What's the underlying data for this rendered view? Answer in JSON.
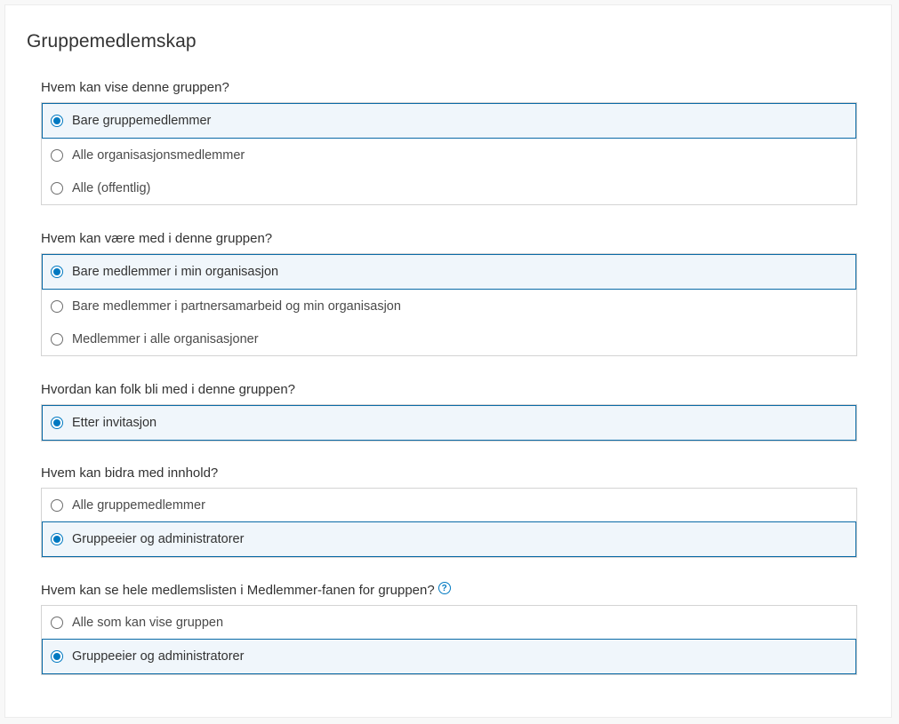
{
  "title": "Gruppemedlemskap",
  "colors": {
    "accent": "#0079c1",
    "selected_bg": "#f0f6fb",
    "border": "#d3d3d3"
  },
  "sections": [
    {
      "question": "Hvem kan vise denne gruppen?",
      "options": [
        {
          "label": "Bare gruppemedlemmer",
          "selected": true
        },
        {
          "label": "Alle organisasjonsmedlemmer",
          "selected": false
        },
        {
          "label": "Alle (offentlig)",
          "selected": false
        }
      ]
    },
    {
      "question": "Hvem kan være med i denne gruppen?",
      "options": [
        {
          "label": "Bare medlemmer i min organisasjon",
          "selected": true
        },
        {
          "label": "Bare medlemmer i partnersamarbeid og min organisasjon",
          "selected": false
        },
        {
          "label": "Medlemmer i alle organisasjoner",
          "selected": false
        }
      ]
    },
    {
      "question": "Hvordan kan folk bli med i denne gruppen?",
      "options": [
        {
          "label": "Etter invitasjon",
          "selected": true
        }
      ]
    },
    {
      "question": "Hvem kan bidra med innhold?",
      "options": [
        {
          "label": "Alle gruppemedlemmer",
          "selected": false
        },
        {
          "label": "Gruppeeier og administratorer",
          "selected": true
        }
      ]
    },
    {
      "question": "Hvem kan se hele medlemslisten i Medlemmer-fanen for gruppen?",
      "help_icon": "question-circle-icon",
      "help_glyph": "?",
      "options": [
        {
          "label": "Alle som kan vise gruppen",
          "selected": false
        },
        {
          "label": "Gruppeeier og administratorer",
          "selected": true
        }
      ]
    }
  ]
}
